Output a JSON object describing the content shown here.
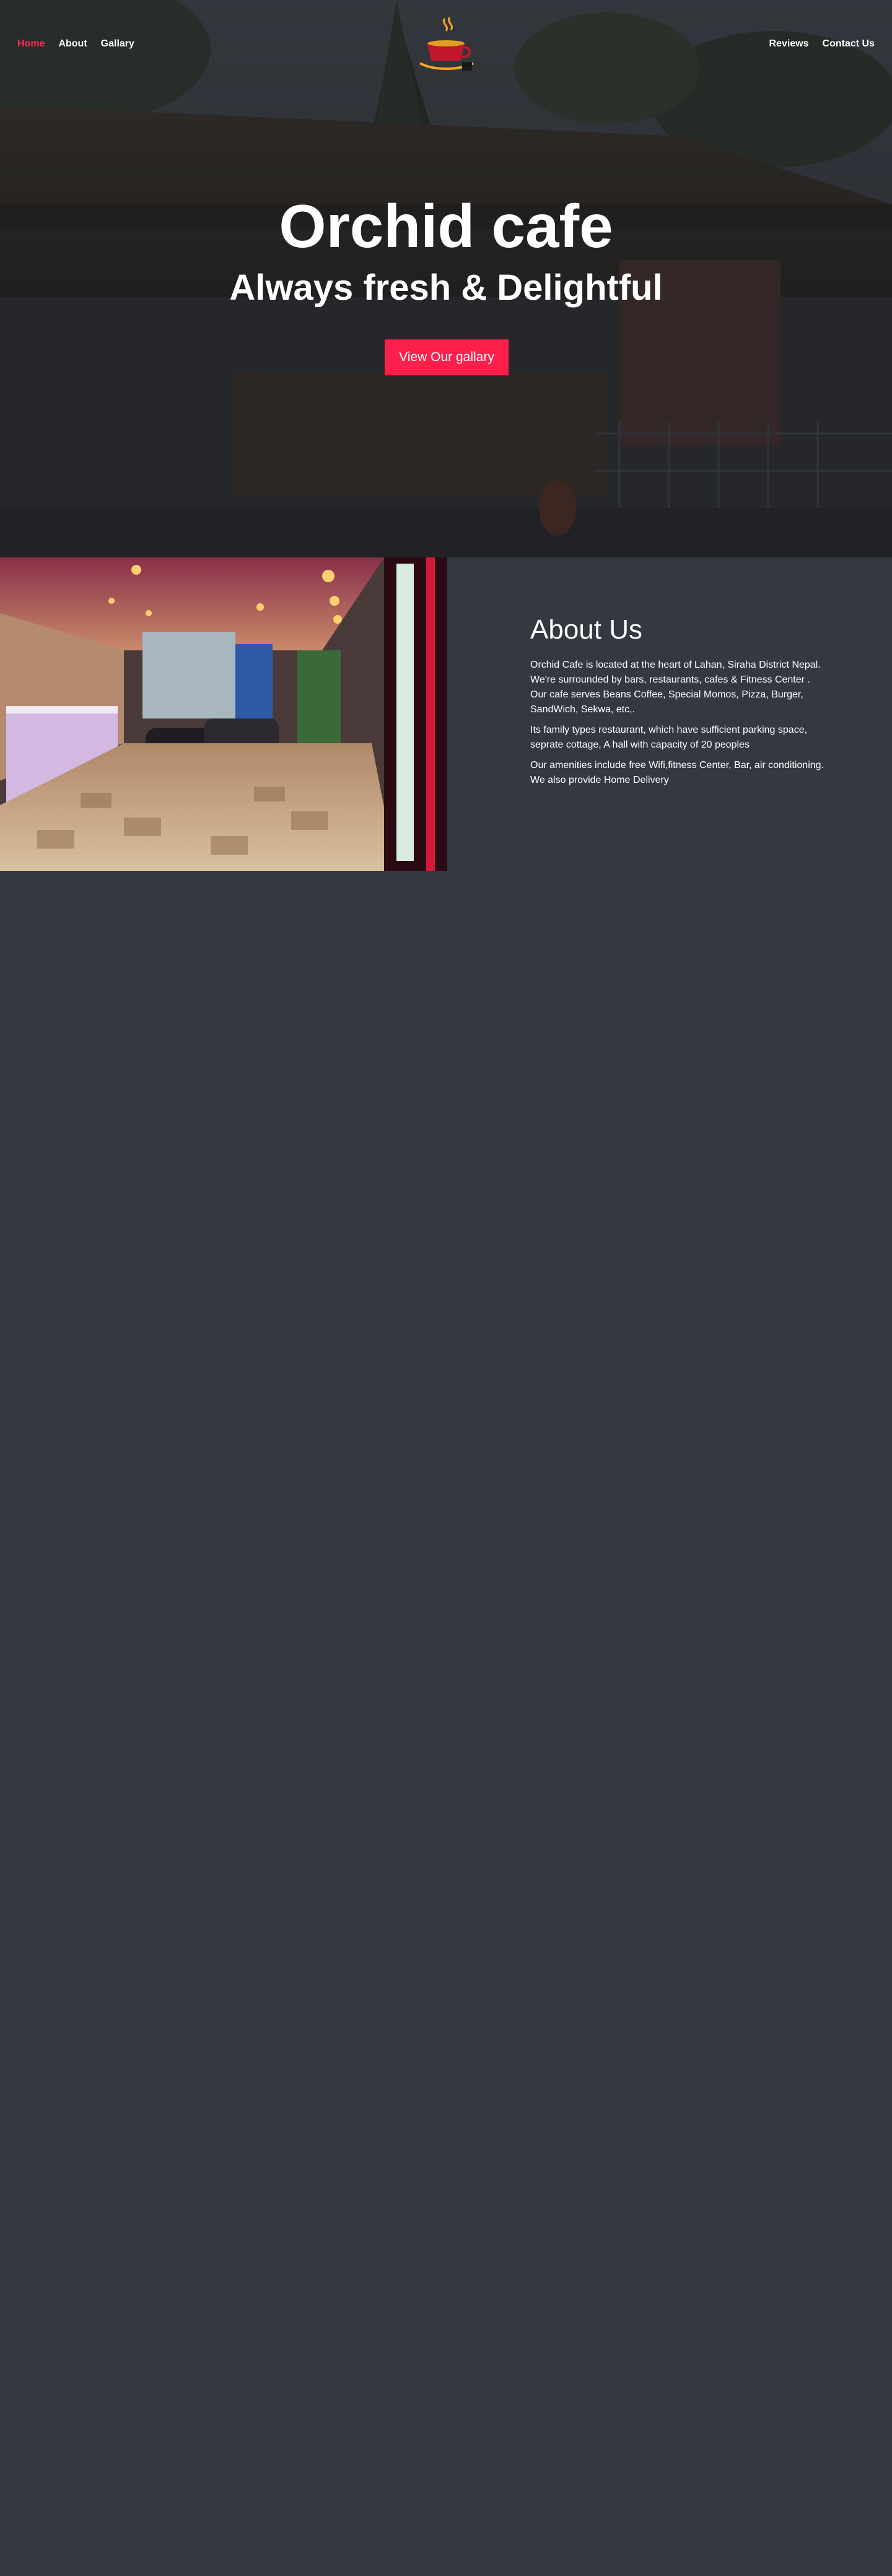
{
  "nav": {
    "left": [
      {
        "label": "Home",
        "active": true
      },
      {
        "label": "About",
        "active": false
      },
      {
        "label": "Gallary",
        "active": false
      }
    ],
    "right": [
      {
        "label": "Reviews",
        "active": false
      },
      {
        "label": "Contact Us",
        "active": false
      }
    ],
    "logo_icon": "coffee-cup-logo"
  },
  "hero": {
    "title": "Orchid cafe",
    "subtitle": "Always fresh & Delightful",
    "button_label": "View Our gallary"
  },
  "about": {
    "heading": "About Us",
    "paragraphs": [
      "Orchid Cafe is located at the heart of Lahan, Siraha District Nepal. We're surrounded by bars, restaurants, cafes & Fitness Center . Our cafe serves Beans Coffee, Special Momos, Pizza, Burger, SandWich, Sekwa, etc,.",
      "Its family types restaurant, which have sufficient parking space, seprate cottage, A hall with capacity of 20 peoples",
      "Our amenities include free Wifi,fitness Center, Bar, air conditioning. We also provide Home Delivery"
    ]
  },
  "colors": {
    "accent": "#ff1f4b",
    "active_nav": "#ff2a55",
    "page_bg": "#343841"
  }
}
